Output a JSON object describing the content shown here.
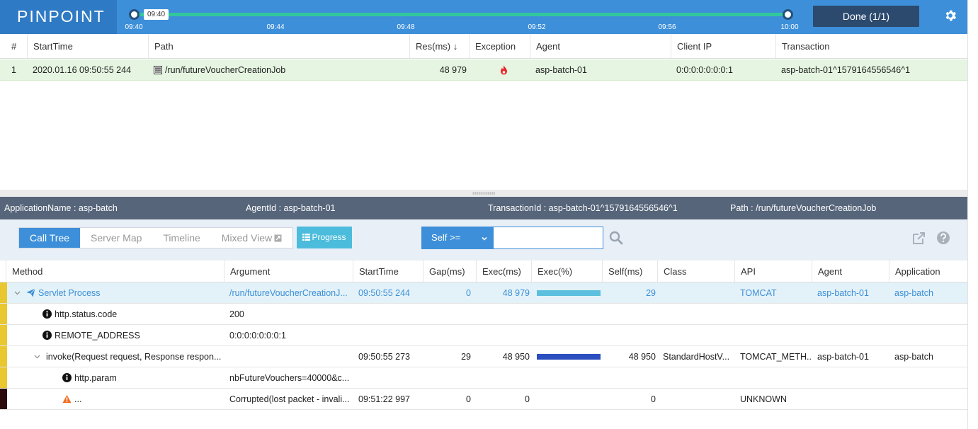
{
  "app": {
    "logo": "PINPOINT",
    "colors": {
      "header": "#3d8fd9",
      "logo_bg": "#2f7ac4",
      "selected_row": "#e5f5e1",
      "accent": "#3d8fd9",
      "progress": "#4cbcdc",
      "marker_yellow": "#e8c730",
      "marker_dark": "#2a0a0a"
    }
  },
  "timeline": {
    "bubble": "09:40",
    "ticks": [
      "09:40",
      "09:44",
      "09:48",
      "09:52",
      "09:56",
      "10:00"
    ],
    "done_button": "Done (1/1)"
  },
  "transactions": {
    "columns": [
      "#",
      "StartTime",
      "Path",
      "Res(ms) ↓",
      "Exception",
      "Agent",
      "Client IP",
      "Transaction"
    ],
    "rows": [
      {
        "num": "1",
        "start": "2020.01.16 09:50:55 244",
        "path": "/run/futureVoucherCreationJob",
        "res": "48 979",
        "exception_icon": "fire-icon",
        "agent": "asp-batch-01",
        "client_ip": "0:0:0:0:0:0:0:1",
        "transaction": "asp-batch-01^1579164556546^1"
      }
    ]
  },
  "info": {
    "application": "ApplicationName : asp-batch",
    "agent": "AgentId : asp-batch-01",
    "transaction": "TransactionId : asp-batch-01^1579164556546^1",
    "path": "Path : /run/futureVoucherCreationJob"
  },
  "toolbar": {
    "tabs": [
      "Call Tree",
      "Server Map",
      "Timeline",
      "Mixed View"
    ],
    "progress": "Progress",
    "self_filter": "Self >=",
    "self_value": ""
  },
  "calltree": {
    "columns": [
      "Method",
      "Argument",
      "StartTime",
      "Gap(ms)",
      "Exec(ms)",
      "Exec(%)",
      "Self(ms)",
      "Class",
      "API",
      "Agent",
      "Application"
    ],
    "rows": [
      {
        "method": "Servlet Process",
        "argument": "/run/futureVoucherCreationJ...",
        "start": "09:50:55 244",
        "gap": "0",
        "exec": "48 979",
        "exec_pct": 100,
        "self": "29",
        "class": "",
        "api": "TOMCAT",
        "agent": "asp-batch-01",
        "application": "asp-batch"
      },
      {
        "method": "http.status.code",
        "argument": "200",
        "start": "",
        "gap": "",
        "exec": "",
        "exec_pct": 0,
        "self": "",
        "class": "",
        "api": "",
        "agent": "",
        "application": ""
      },
      {
        "method": "REMOTE_ADDRESS",
        "argument": "0:0:0:0:0:0:0:1",
        "start": "",
        "gap": "",
        "exec": "",
        "exec_pct": 0,
        "self": "",
        "class": "",
        "api": "",
        "agent": "",
        "application": ""
      },
      {
        "method": "invoke(Request request, Response respon...",
        "argument": "",
        "start": "09:50:55 273",
        "gap": "29",
        "exec": "48 950",
        "exec_pct": 100,
        "self": "48 950",
        "class": "StandardHostV...",
        "api": "TOMCAT_METH...",
        "agent": "asp-batch-01",
        "application": "asp-batch"
      },
      {
        "method": "http.param",
        "argument": "nbFutureVouchers=40000&c...",
        "start": "",
        "gap": "",
        "exec": "",
        "exec_pct": 0,
        "self": "",
        "class": "",
        "api": "",
        "agent": "",
        "application": ""
      },
      {
        "method": "...",
        "argument": "Corrupted(lost packet - invali...",
        "start": "09:51:22 997",
        "gap": "0",
        "exec": "0",
        "exec_pct": 0,
        "self": "0",
        "class": "",
        "api": "UNKNOWN",
        "agent": "",
        "application": ""
      }
    ]
  }
}
